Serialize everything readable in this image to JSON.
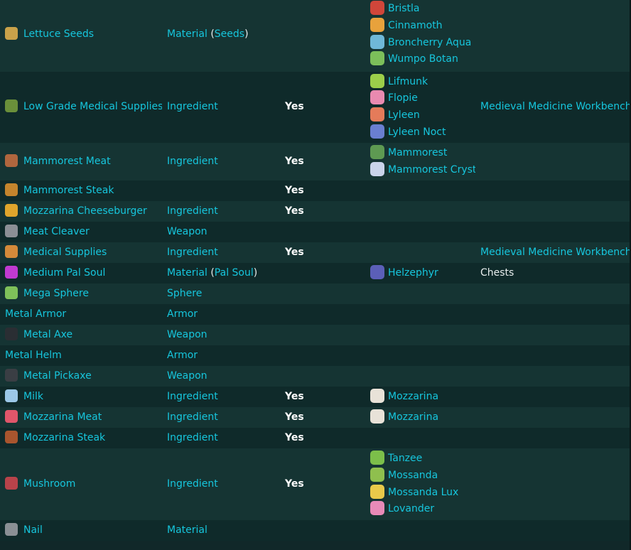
{
  "rows": [
    {
      "item": "Lettuce Seeds",
      "item_icon": "seed-bag-icon",
      "icon_color": "#c9a24a",
      "type": "Material",
      "subtype": "Seeds",
      "consumable": "",
      "pals": [
        {
          "name": "Bristla",
          "icon": "bristla-icon",
          "color": "#d0463a"
        },
        {
          "name": "Cinnamoth",
          "icon": "cinnamoth-icon",
          "color": "#e8a23c"
        },
        {
          "name": "Broncherry Aqua",
          "icon": "broncherry-aqua-icon",
          "color": "#6fb8d8"
        },
        {
          "name": "Wumpo Botan",
          "icon": "wumpo-botan-icon",
          "color": "#7cbf5a"
        }
      ],
      "source": ""
    },
    {
      "item": "Low Grade Medical Supplies",
      "item_icon": "medical-bowl-icon",
      "icon_color": "#6a8f3a",
      "type": "Ingredient",
      "subtype": "",
      "consumable": "Yes",
      "pals": [
        {
          "name": "Lifmunk",
          "icon": "lifmunk-icon",
          "color": "#9ccf4a"
        },
        {
          "name": "Flopie",
          "icon": "flopie-icon",
          "color": "#e98ab0"
        },
        {
          "name": "Lyleen",
          "icon": "lyleen-icon",
          "color": "#e47b5a"
        },
        {
          "name": "Lyleen Noct",
          "icon": "lyleen-noct-icon",
          "color": "#6a7fd0"
        }
      ],
      "source": "Medieval Medicine Workbench"
    },
    {
      "item": "Mammorest Meat",
      "item_icon": "meat-icon",
      "icon_color": "#b0663e",
      "type": "Ingredient",
      "subtype": "",
      "consumable": "Yes",
      "pals": [
        {
          "name": "Mammorest",
          "icon": "mammorest-icon",
          "color": "#5e9a52"
        },
        {
          "name": "Mammorest Cryst",
          "icon": "mammorest-cryst-icon",
          "color": "#c9d3ea"
        }
      ],
      "source": ""
    },
    {
      "item": "Mammorest Steak",
      "item_icon": "steak-icon",
      "icon_color": "#c4842d",
      "type": "",
      "subtype": "",
      "consumable": "Yes",
      "pals": [],
      "source": ""
    },
    {
      "item": "Mozzarina Cheeseburger",
      "item_icon": "cheeseburger-icon",
      "icon_color": "#e0a52c",
      "type": "Ingredient",
      "subtype": "",
      "consumable": "Yes",
      "pals": [],
      "source": ""
    },
    {
      "item": "Meat Cleaver",
      "item_icon": "cleaver-icon",
      "icon_color": "#8c8f95",
      "type": "Weapon",
      "subtype": "",
      "consumable": "",
      "pals": [],
      "source": ""
    },
    {
      "item": "Medical Supplies",
      "item_icon": "syringe-icon",
      "icon_color": "#d48a3a",
      "type": "Ingredient",
      "subtype": "",
      "consumable": "Yes",
      "pals": [],
      "source": "Medieval Medicine Workbench"
    },
    {
      "item": "Medium Pal Soul",
      "item_icon": "pal-soul-icon",
      "icon_color": "#c03ad0",
      "type": "Material",
      "subtype": "Pal Soul",
      "consumable": "",
      "pals": [
        {
          "name": "Helzephyr",
          "icon": "helzephyr-icon",
          "color": "#5b5fb8"
        }
      ],
      "source": "Chests"
    },
    {
      "item": "Mega Sphere",
      "item_icon": "sphere-icon",
      "icon_color": "#7fc05a",
      "type": "Sphere",
      "subtype": "",
      "consumable": "",
      "pals": [],
      "source": ""
    },
    {
      "item": "Metal Armor",
      "item_icon": "",
      "icon_color": "",
      "type": "Armor",
      "subtype": "",
      "consumable": "",
      "pals": [],
      "source": ""
    },
    {
      "item": "Metal Axe",
      "item_icon": "axe-icon",
      "icon_color": "#2a2e33",
      "type": "Weapon",
      "subtype": "",
      "consumable": "",
      "pals": [],
      "source": ""
    },
    {
      "item": "Metal Helm",
      "item_icon": "",
      "icon_color": "",
      "type": "Armor",
      "subtype": "",
      "consumable": "",
      "pals": [],
      "source": ""
    },
    {
      "item": "Metal Pickaxe",
      "item_icon": "pickaxe-icon",
      "icon_color": "#3a3e44",
      "type": "Weapon",
      "subtype": "",
      "consumable": "",
      "pals": [],
      "source": ""
    },
    {
      "item": "Milk",
      "item_icon": "milk-bottle-icon",
      "icon_color": "#9cc8e8",
      "type": "Ingredient",
      "subtype": "",
      "consumable": "Yes",
      "pals": [
        {
          "name": "Mozzarina",
          "icon": "mozzarina-icon",
          "color": "#e8e2d8"
        }
      ],
      "source": ""
    },
    {
      "item": "Mozzarina Meat",
      "item_icon": "raw-meat-icon",
      "icon_color": "#e0566a",
      "type": "Ingredient",
      "subtype": "",
      "consumable": "Yes",
      "pals": [
        {
          "name": "Mozzarina",
          "icon": "mozzarina-icon",
          "color": "#e8e2d8"
        }
      ],
      "source": ""
    },
    {
      "item": "Mozzarina Steak",
      "item_icon": "steak-icon",
      "icon_color": "#a8552e",
      "type": "Ingredient",
      "subtype": "",
      "consumable": "Yes",
      "pals": [],
      "source": ""
    },
    {
      "item": "Mushroom",
      "item_icon": "mushroom-icon",
      "icon_color": "#b8434a",
      "type": "Ingredient",
      "subtype": "",
      "consumable": "Yes",
      "pals": [
        {
          "name": "Tanzee",
          "icon": "tanzee-icon",
          "color": "#7cbf4a"
        },
        {
          "name": "Mossanda",
          "icon": "mossanda-icon",
          "color": "#8fbf4e"
        },
        {
          "name": "Mossanda Lux",
          "icon": "mossanda-lux-icon",
          "color": "#e8c94a"
        },
        {
          "name": "Lovander",
          "icon": "lovander-icon",
          "color": "#e88ab8"
        }
      ],
      "source": ""
    },
    {
      "item": "Nail",
      "item_icon": "nail-icon",
      "icon_color": "#8a8f94",
      "type": "Material",
      "subtype": "",
      "consumable": "",
      "pals": [],
      "source": ""
    }
  ]
}
